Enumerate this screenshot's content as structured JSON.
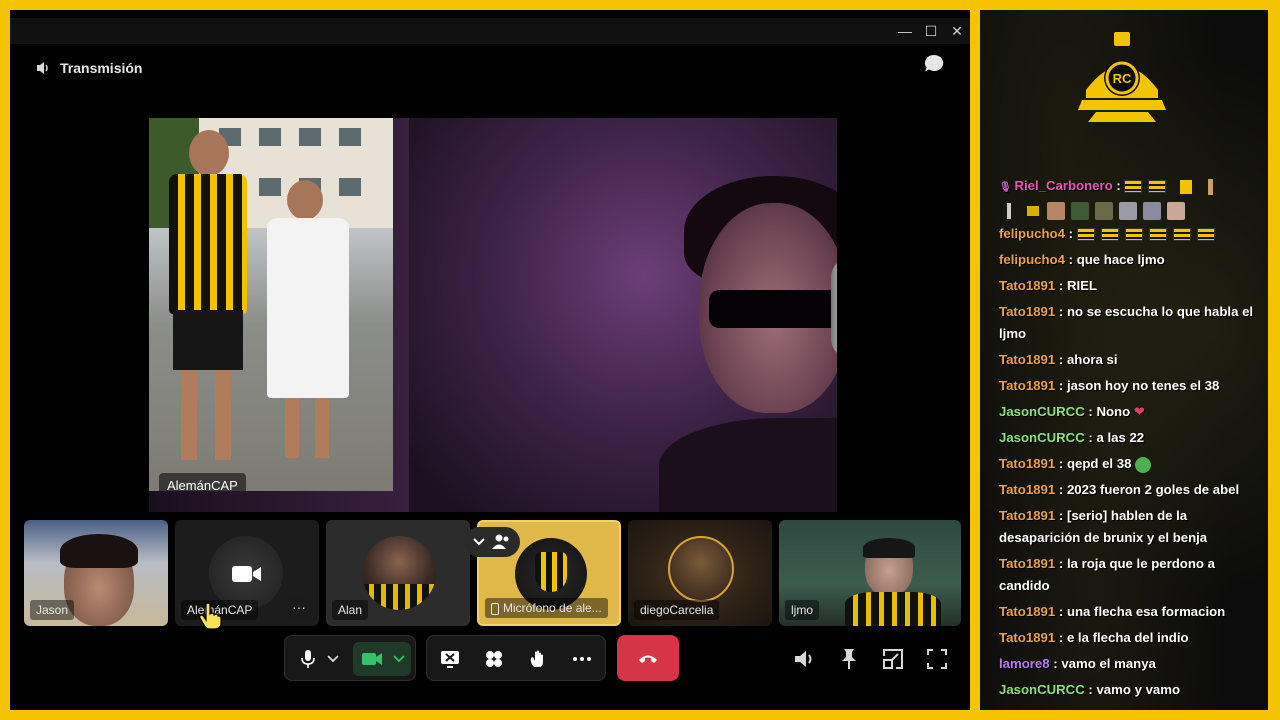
{
  "window": {
    "title": "Transmisión",
    "controls": [
      "minimize",
      "maximize",
      "close"
    ]
  },
  "main_stage": {
    "pip_label": "AlemánCAP"
  },
  "participants": [
    {
      "name": "Jason"
    },
    {
      "name": "AlemánCAP"
    },
    {
      "name": "Alan"
    },
    {
      "name": "Micrófono de ale..."
    },
    {
      "name": "diegoCarcelia"
    },
    {
      "name": "ljmo"
    }
  ],
  "tile_options_label": "···",
  "chat": {
    "messages": [
      {
        "user": "Riel_Carbonero",
        "color": "#e05ab4",
        "text": "",
        "has_emotes": true
      },
      {
        "user": "felipucho4",
        "color": "#e8a04a",
        "text": "",
        "has_emotes": true
      },
      {
        "user": "felipucho4",
        "color": "#e8a04a",
        "text": "que hace ljmo"
      },
      {
        "user": "Tato1891",
        "color": "#e8a04a",
        "text": "RIEL"
      },
      {
        "user": "Tato1891",
        "color": "#e8a04a",
        "text": "no se escucha lo que habla el ljmo"
      },
      {
        "user": "Tato1891",
        "color": "#e8a04a",
        "text": "ahora si"
      },
      {
        "user": "Tato1891",
        "color": "#e8a04a",
        "text": "jason hoy no tenes el 38"
      },
      {
        "user": "JasonCURCC",
        "color": "#8fe07a",
        "text": "Nono"
      },
      {
        "user": "JasonCURCC",
        "color": "#8fe07a",
        "text": "a las 22"
      },
      {
        "user": "Tato1891",
        "color": "#e8a04a",
        "text": "qepd el 38"
      },
      {
        "user": "Tato1891",
        "color": "#e8a04a",
        "text": "2023 fueron 2 goles de abel"
      },
      {
        "user": "Tato1891",
        "color": "#e8a04a",
        "text": "[serio] hablen de la desaparición de brunix y el benja"
      },
      {
        "user": "Tato1891",
        "color": "#e8a04a",
        "text": "la roja que le perdono a candido"
      },
      {
        "user": "Tato1891",
        "color": "#e8a04a",
        "text": "una flecha esa formacion"
      },
      {
        "user": "Tato1891",
        "color": "#e8a04a",
        "text": "e la flecha del indio"
      },
      {
        "user": "lamore8",
        "color": "#b77aee",
        "text": "vamo el manya"
      },
      {
        "user": "JasonCURCC",
        "color": "#8fe07a",
        "text": "vamo y vamo"
      }
    ]
  },
  "colors": {
    "frame": "#f5c400",
    "hangup": "#d63447",
    "camera_on": "#35c26b"
  },
  "icons": [
    "broadcast-icon",
    "chat-bubble-icon",
    "microphone-icon",
    "camera-icon",
    "share-screen-icon",
    "reactions-icon",
    "raise-hand-icon",
    "more-icon",
    "phone-hangup-icon",
    "volume-icon",
    "pin-icon",
    "exit-fullscreen-icon",
    "fullscreen-icon"
  ]
}
